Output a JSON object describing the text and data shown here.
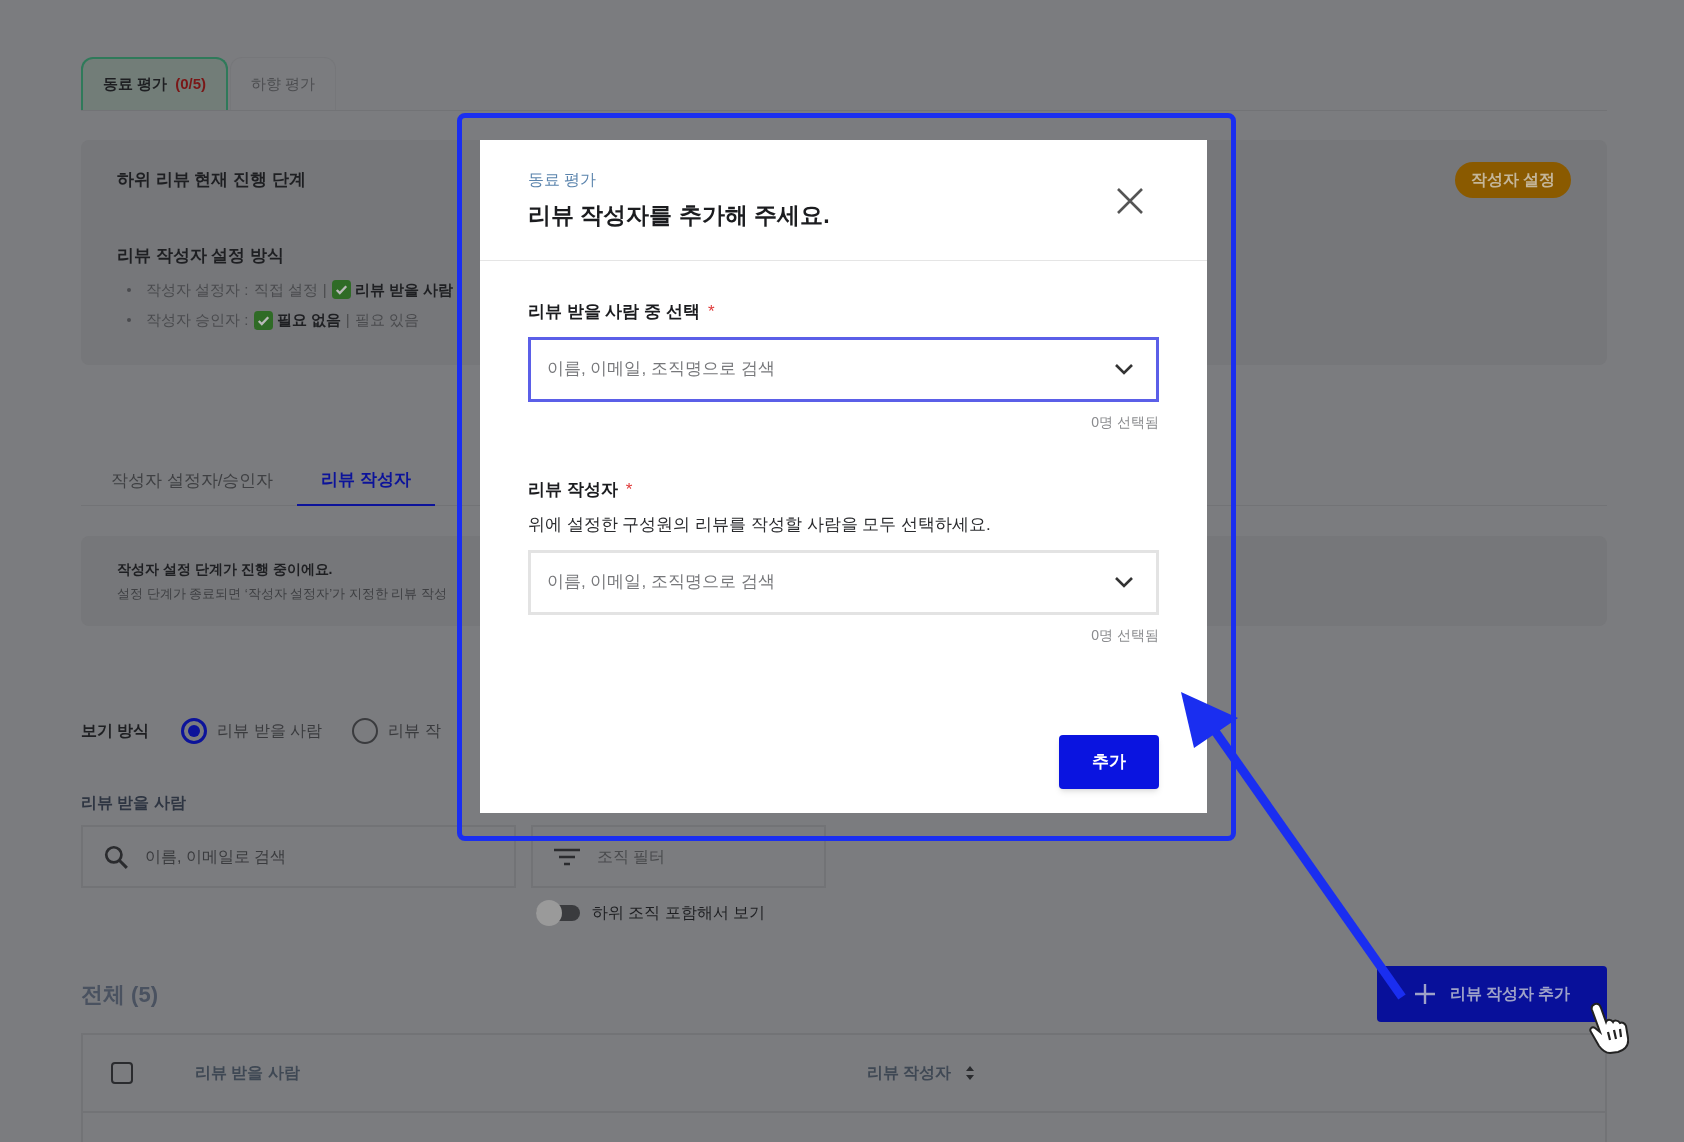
{
  "top_tabs": [
    {
      "label": "동료 평가",
      "count": "(0/5)",
      "selected": true
    },
    {
      "label": "하향 평가",
      "selected": false
    }
  ],
  "status_card": {
    "title": "하위 리뷰 현재 진행 단계",
    "action": "작성자 설정",
    "method_title": "리뷰 작성자 설정 방식",
    "settings": [
      {
        "label": "작성자 설정자 :",
        "separator": "|",
        "options": [
          {
            "text": "직접 설정",
            "checked": false
          },
          {
            "text": "리뷰 받을 사람",
            "checked": true
          }
        ]
      },
      {
        "label": "작성자 승인자 :",
        "separator": "|",
        "options": [
          {
            "text": "필요 없음",
            "checked": true
          },
          {
            "text": "필요 있음",
            "checked": false
          }
        ]
      }
    ]
  },
  "sub_tabs": [
    {
      "label": "작성자 설정자/승인자",
      "selected": false
    },
    {
      "label": "리뷰 작성자",
      "selected": true
    }
  ],
  "notice": {
    "title": "작성자 설정 단계가 진행 중이에요.",
    "body": "설정 단계가 종료되면 ‘작성자 설정자’가 지정한 리뷰 작성"
  },
  "view_mode": {
    "label": "보기 방식",
    "options": [
      {
        "label": "리뷰 받을 사람",
        "selected": true
      },
      {
        "label": "리뷰 작",
        "selected": false
      }
    ]
  },
  "filters": {
    "label": "리뷰 받을 사람",
    "search_placeholder": "이름, 이메일로 검색",
    "org_filter": "조직 필터",
    "include_sub_orgs": {
      "label": "하위 조직 포함해서 보기",
      "on": false
    }
  },
  "list": {
    "title": "전체 (5)",
    "add_button": "리뷰 작성자 추가",
    "select_all_checked": false,
    "columns": [
      {
        "label": "리뷰 받을 사람",
        "sortable": false
      },
      {
        "label": "리뷰 작성자",
        "sortable": true
      }
    ]
  },
  "modal": {
    "eyebrow": "동료 평가",
    "title": "리뷰 작성자를 추가해 주세요.",
    "submit": "추가",
    "fields": [
      {
        "label": "리뷰 받을 사람 중 선택",
        "mark": "*",
        "placeholder": "이름, 이메일, 조직명으로 검색",
        "focused": true,
        "count": "0명 선택됨"
      },
      {
        "label": "리뷰 작성자",
        "mark": "*",
        "description": "위에 설정한 구성원의 리뷰를 작성할 사람을 모두 선택하세요.",
        "placeholder": "이름, 이메일, 조직명으로 검색",
        "focused": false,
        "count": "0명 선택됨"
      }
    ]
  }
}
